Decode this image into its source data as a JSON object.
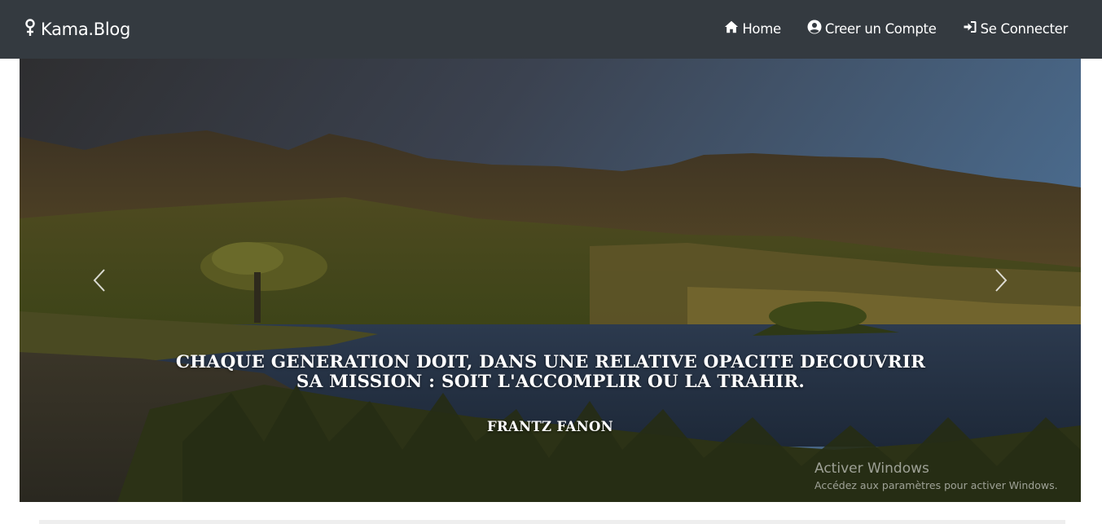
{
  "navbar": {
    "brand": "Kama.Blog",
    "links": [
      {
        "label": "Home",
        "icon": "home-icon"
      },
      {
        "label": "Creer un Compte",
        "icon": "user-circle-icon"
      },
      {
        "label": "Se Connecter",
        "icon": "sign-in-icon"
      }
    ]
  },
  "carousel": {
    "quote": "CHAQUE GENERATION DOIT, DANS UNE RELATIVE OPACITE DECOUVRIR SA MISSION : SOIT L'ACCOMPLIR OU LA TRAHIR.",
    "author": "FRANTZ FANON",
    "prev_icon": "chevron-left-icon",
    "next_icon": "chevron-right-icon"
  },
  "os_watermark": {
    "title": "Activer Windows",
    "subtitle": "Accédez aux paramètres pour activer Windows."
  },
  "colors": {
    "navbar_bg": "#343a40",
    "text": "#ffffff"
  }
}
